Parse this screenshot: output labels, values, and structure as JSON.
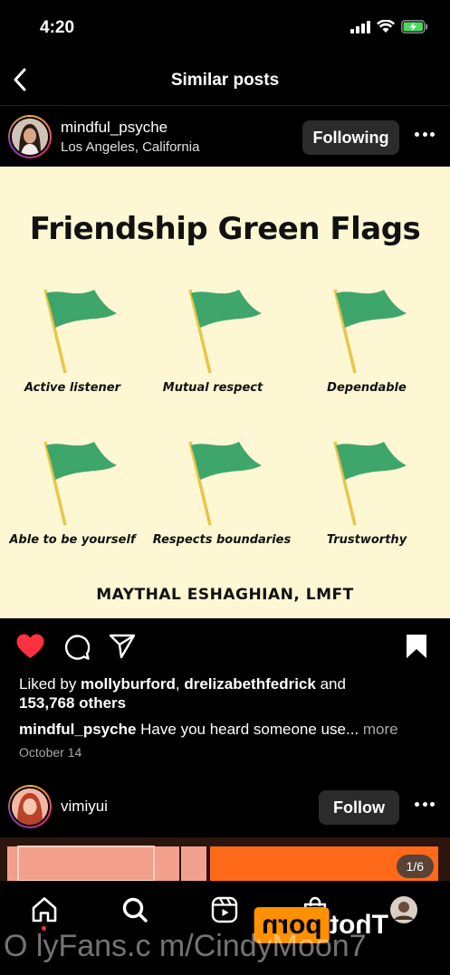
{
  "status_bar": {
    "time": "4:20"
  },
  "nav": {
    "title": "Similar posts"
  },
  "post1": {
    "username": "mindful_psyche",
    "location": "Los Angeles, California",
    "follow_label": "Following",
    "image": {
      "title": "Friendship Green Flags",
      "flags": [
        {
          "label": "Active listener"
        },
        {
          "label": "Mutual respect"
        },
        {
          "label": "Dependable"
        },
        {
          "label": "Able to be yourself"
        },
        {
          "label": "Respects boundaries"
        },
        {
          "label": "Trustworthy"
        }
      ],
      "credit": "MAYTHAL ESHAGHIAN, LMFT",
      "flag_color": "#3fa66b",
      "pole_color": "#e9c646",
      "background": "#fdf7d4"
    },
    "liked": true,
    "saved": true,
    "likes_prefix": "Liked by ",
    "liker1": "mollyburford",
    "likes_sep": ", ",
    "liker2": "drelizabethfedrick",
    "likes_and": " and",
    "likes_count": "153,768 others",
    "caption_user": "mindful_psyche",
    "caption_text": "Have you heard someone use...",
    "caption_more": "more",
    "date": "October 14"
  },
  "post2": {
    "username": "vimiyui",
    "follow_label": "Follow",
    "counter": "1/6"
  },
  "tabs": [
    {
      "icon": "home-icon"
    },
    {
      "icon": "search-icon"
    },
    {
      "icon": "reels-icon"
    },
    {
      "icon": "shop-icon"
    },
    {
      "icon": "profile-avatar"
    }
  ],
  "overlay": {
    "watermark": "O lyFans.c m/CindyMoon7",
    "logo_left": "porn",
    "logo_right": "Thot"
  },
  "colors": {
    "like_red": "#ff3040",
    "accent_orange": "#ff9000"
  }
}
